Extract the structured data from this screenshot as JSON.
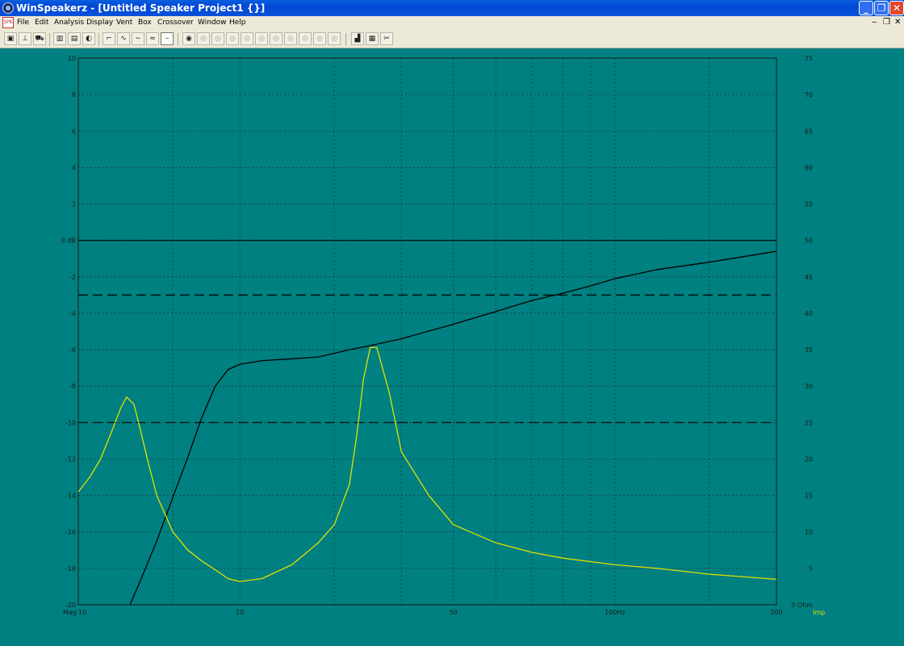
{
  "window": {
    "title": "WinSpeakerz - [Untitled Speaker Project1 {}]",
    "controls": [
      "_",
      "❐",
      "✕"
    ]
  },
  "menu": {
    "items": [
      "File",
      "Edit",
      "Analysis",
      "Display",
      "Vent",
      "Box",
      "Crossover",
      "Window",
      "Help"
    ],
    "child_controls": [
      "‒",
      "❐",
      "✕"
    ]
  },
  "colors": {
    "background": "#008080",
    "magnitude_curve": "#000000",
    "impedance_curve": "#e0e000",
    "grid": "#1a3a3a"
  },
  "chart_data": {
    "type": "line",
    "x_scale": "log",
    "xlim": [
      10,
      200
    ],
    "x_ticks": [
      {
        "value": 10,
        "label": "10"
      },
      {
        "value": 20,
        "label": "20"
      },
      {
        "value": 50,
        "label": "50"
      },
      {
        "value": 100,
        "label": "100Hz"
      },
      {
        "value": 200,
        "label": "200"
      }
    ],
    "x_grid": [
      15,
      20,
      30,
      40,
      50,
      60,
      70,
      80,
      90,
      100,
      150
    ],
    "ylim_left": [
      -20,
      10
    ],
    "y_left_ticks": [
      {
        "value": 10,
        "label": "10"
      },
      {
        "value": 8,
        "label": "8"
      },
      {
        "value": 6,
        "label": "6"
      },
      {
        "value": 4,
        "label": "4"
      },
      {
        "value": 2,
        "label": "2"
      },
      {
        "value": 0,
        "label": "0 dB"
      },
      {
        "value": -2,
        "label": "-2"
      },
      {
        "value": -4,
        "label": "-4"
      },
      {
        "value": -6,
        "label": "-6"
      },
      {
        "value": -8,
        "label": "-8"
      },
      {
        "value": -10,
        "label": "-10"
      },
      {
        "value": -12,
        "label": "-12"
      },
      {
        "value": -14,
        "label": "-14"
      },
      {
        "value": -16,
        "label": "-16"
      },
      {
        "value": -18,
        "label": "-18"
      },
      {
        "value": -20,
        "label": "-20"
      }
    ],
    "ylim_right": [
      0,
      75
    ],
    "y_right_ticks": [
      {
        "value": 75,
        "label": "75"
      },
      {
        "value": 70,
        "label": "70"
      },
      {
        "value": 65,
        "label": "65"
      },
      {
        "value": 60,
        "label": "60"
      },
      {
        "value": 55,
        "label": "55"
      },
      {
        "value": 50,
        "label": "50"
      },
      {
        "value": 45,
        "label": "45"
      },
      {
        "value": 40,
        "label": "40"
      },
      {
        "value": 35,
        "label": "35"
      },
      {
        "value": 30,
        "label": "30"
      },
      {
        "value": 25,
        "label": "25"
      },
      {
        "value": 20,
        "label": "20"
      },
      {
        "value": 15,
        "label": "15"
      },
      {
        "value": 10,
        "label": "10"
      },
      {
        "value": 5,
        "label": "5"
      },
      {
        "value": 0,
        "label": "0 Ohm"
      }
    ],
    "left_axis_label": "Mag",
    "right_axis_label": "Imp",
    "reference_lines": [
      {
        "axis": "left",
        "value": 0,
        "style": "solid"
      },
      {
        "axis": "left",
        "value": -3,
        "style": "dashed"
      },
      {
        "axis": "left",
        "value": -10,
        "style": "dashed"
      }
    ],
    "series": [
      {
        "axis": "left",
        "color": "#000000",
        "x": [
          12.48,
          13,
          14,
          15,
          16,
          17,
          18,
          19,
          20,
          22,
          25,
          28,
          32,
          36,
          40,
          50,
          60,
          70,
          80,
          90,
          100,
          120,
          150,
          200
        ],
        "y": [
          -20.0,
          -18.8,
          -16.5,
          -14.1,
          -11.9,
          -9.7,
          -8.0,
          -7.1,
          -6.8,
          -6.6,
          -6.5,
          -6.4,
          -6.0,
          -5.7,
          -5.4,
          -4.6,
          -3.9,
          -3.3,
          -2.9,
          -2.5,
          -2.1,
          -1.6,
          -1.2,
          -0.6
        ]
      },
      {
        "axis": "right",
        "color": "#e0e000",
        "x": [
          10,
          10.5,
          11,
          11.5,
          12,
          12.3,
          12.7,
          13,
          13.5,
          14,
          15,
          16,
          17,
          18,
          19,
          20,
          22,
          25,
          28,
          30,
          32,
          33,
          34,
          35,
          36,
          38,
          40,
          45,
          50,
          60,
          70,
          80,
          100,
          120,
          150,
          200
        ],
        "y": [
          15.5,
          17.5,
          20.0,
          23.5,
          27.0,
          28.5,
          27.5,
          24.5,
          19.5,
          15.0,
          10.0,
          7.5,
          6.0,
          4.8,
          3.6,
          3.2,
          3.6,
          5.5,
          8.5,
          11.0,
          16.5,
          23.0,
          31.0,
          35.3,
          35.3,
          29.0,
          21.0,
          15.0,
          11.0,
          8.5,
          7.2,
          6.4,
          5.5,
          5.0,
          4.2,
          3.5
        ]
      }
    ]
  }
}
